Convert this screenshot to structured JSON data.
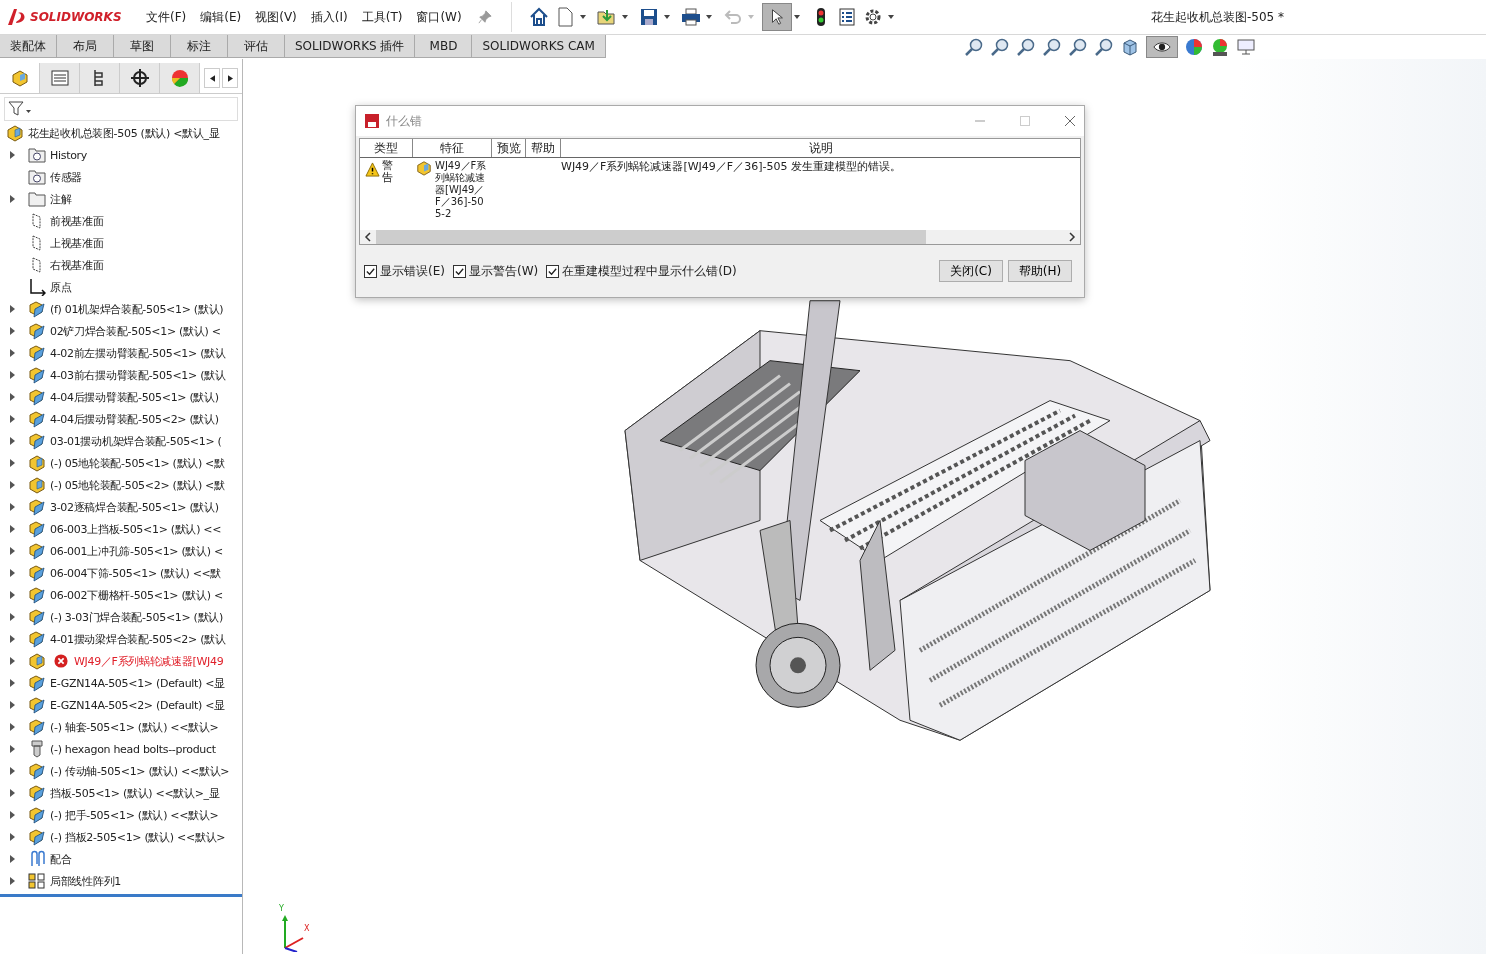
{
  "app": {
    "logo": "SOLIDWORKS",
    "document_title": "花生起收机总装图-505 *"
  },
  "menu": [
    "文件(F)",
    "编辑(E)",
    "视图(V)",
    "插入(I)",
    "工具(T)",
    "窗口(W)"
  ],
  "command_tabs": [
    "装配体",
    "布局",
    "草图",
    "标注",
    "评估",
    "SOLIDWORKS 插件",
    "MBD",
    "SOLIDWORKS CAM"
  ],
  "tree": [
    {
      "kind": "root",
      "label": "花生起收机总装图-505 (默认) <默认_显",
      "expandable": false,
      "error": false
    },
    {
      "kind": "history",
      "label": "History",
      "expandable": true,
      "error": false
    },
    {
      "kind": "sensor",
      "label": "传感器",
      "expandable": false,
      "error": false
    },
    {
      "kind": "annotation",
      "label": "注解",
      "expandable": true,
      "error": false
    },
    {
      "kind": "plane",
      "label": "前视基准面",
      "expandable": false,
      "error": false
    },
    {
      "kind": "plane",
      "label": "上视基准面",
      "expandable": false,
      "error": false
    },
    {
      "kind": "plane",
      "label": "右视基准面",
      "expandable": false,
      "error": false
    },
    {
      "kind": "origin",
      "label": "原点",
      "expandable": false,
      "error": false
    },
    {
      "kind": "assembly",
      "label": "(f) 01机架焊合装配-505<1> (默认)",
      "expandable": true,
      "error": false
    },
    {
      "kind": "assembly",
      "label": "02铲刀焊合装配-505<1> (默认) <",
      "expandable": true,
      "error": false
    },
    {
      "kind": "assembly",
      "label": "4-02前左摆动臂装配-505<1> (默认",
      "expandable": true,
      "error": false
    },
    {
      "kind": "assembly",
      "label": "4-03前右摆动臂装配-505<1> (默认",
      "expandable": true,
      "error": false
    },
    {
      "kind": "assembly",
      "label": "4-04后摆动臂装配-505<1> (默认)",
      "expandable": true,
      "error": false
    },
    {
      "kind": "assembly",
      "label": "4-04后摆动臂装配-505<2> (默认)",
      "expandable": true,
      "error": false
    },
    {
      "kind": "assembly",
      "label": "03-01摆动机架焊合装配-505<1> (",
      "expandable": true,
      "error": false
    },
    {
      "kind": "part",
      "label": "(-) 05地轮装配-505<1> (默认) <默",
      "expandable": true,
      "error": false
    },
    {
      "kind": "part",
      "label": "(-) 05地轮装配-505<2> (默认) <默",
      "expandable": true,
      "error": false
    },
    {
      "kind": "assembly",
      "label": "3-02逐稿焊合装配-505<1> (默认)",
      "expandable": true,
      "error": false
    },
    {
      "kind": "assembly",
      "label": "06-003上挡板-505<1> (默认) <<",
      "expandable": true,
      "error": false
    },
    {
      "kind": "assembly",
      "label": "06-001上冲孔筛-505<1> (默认) <",
      "expandable": true,
      "error": false
    },
    {
      "kind": "assembly",
      "label": "06-004下筛-505<1> (默认) <<默",
      "expandable": true,
      "error": false
    },
    {
      "kind": "assembly",
      "label": "06-002下栅格杆-505<1> (默认) <",
      "expandable": true,
      "error": false
    },
    {
      "kind": "assembly",
      "label": "(-) 3-03门焊合装配-505<1> (默认)",
      "expandable": true,
      "error": false
    },
    {
      "kind": "assembly",
      "label": "4-01摆动梁焊合装配-505<2> (默认",
      "expandable": true,
      "error": false
    },
    {
      "kind": "part",
      "label": "WJ49／F系列蜗轮减速器[WJ49",
      "expandable": true,
      "error": true
    },
    {
      "kind": "assembly",
      "label": "E-GZN14A-505<1> (Default) <显",
      "expandable": true,
      "error": false
    },
    {
      "kind": "assembly",
      "label": "E-GZN14A-505<2> (Default) <显",
      "expandable": true,
      "error": false
    },
    {
      "kind": "assembly",
      "label": "(-) 轴套-505<1> (默认) <<默认>",
      "expandable": true,
      "error": false
    },
    {
      "kind": "bolt",
      "label": "(-) hexagon head bolts--product",
      "expandable": true,
      "error": false
    },
    {
      "kind": "assembly",
      "label": "(-) 传动轴-505<1> (默认) <<默认>",
      "expandable": true,
      "error": false
    },
    {
      "kind": "assembly",
      "label": "挡板-505<1> (默认) <<默认>_显",
      "expandable": true,
      "error": false
    },
    {
      "kind": "assembly",
      "label": "(-) 把手-505<1> (默认) <<默认>",
      "expandable": true,
      "error": false
    },
    {
      "kind": "assembly",
      "label": "(-) 挡板2-505<1> (默认) <<默认>",
      "expandable": true,
      "error": false
    },
    {
      "kind": "mates",
      "label": "配合",
      "expandable": true,
      "error": false
    },
    {
      "kind": "pattern",
      "label": "局部线性阵列1",
      "expandable": true,
      "error": false
    }
  ],
  "dialog": {
    "title": "什么错",
    "columns": [
      "类型",
      "特征",
      "预览",
      "帮助",
      "说明"
    ],
    "rows": [
      {
        "type": "警告",
        "feature": "WJ49／F系列蜗轮减速器[WJ49／F／36]-505-2",
        "description": "WJ49／F系列蜗轮减速器[WJ49／F／36]-505 发生重建模型的错误。"
      }
    ],
    "options": [
      {
        "label": "显示错误(E)",
        "checked": true
      },
      {
        "label": "显示警告(W)",
        "checked": true
      },
      {
        "label": "在重建模型过程中显示什么错(D)",
        "checked": true
      }
    ],
    "buttons": [
      "关闭(C)",
      "帮助(H)"
    ]
  },
  "triad": {
    "y_label": "Y",
    "x_label": "X"
  }
}
